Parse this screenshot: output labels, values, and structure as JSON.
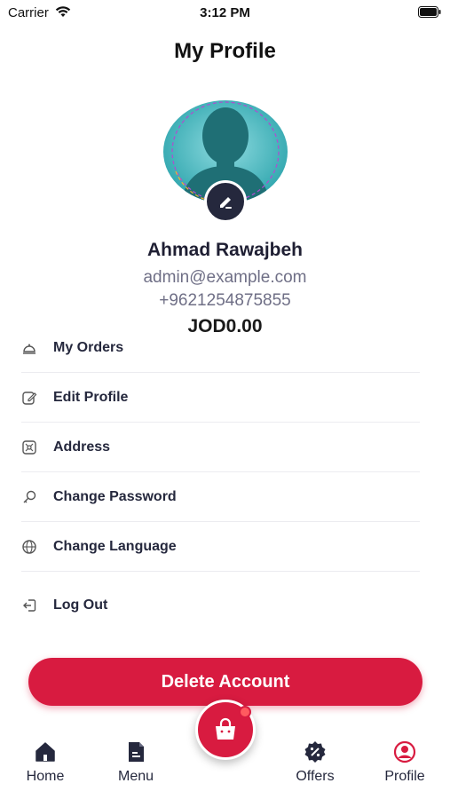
{
  "status_bar": {
    "carrier": "Carrier",
    "time": "3:12 PM"
  },
  "header": {
    "title": "My Profile"
  },
  "profile": {
    "name": "Ahmad Rawajbeh",
    "email": "admin@example.com",
    "phone": "+9621254875855",
    "balance": "JOD0.00"
  },
  "menu": {
    "items": [
      {
        "label": "My Orders",
        "icon": "orders-icon"
      },
      {
        "label": "Edit Profile",
        "icon": "edit-icon"
      },
      {
        "label": "Address",
        "icon": "map-icon"
      },
      {
        "label": "Change Password",
        "icon": "key-icon"
      },
      {
        "label": "Change Language",
        "icon": "globe-icon"
      }
    ],
    "logout_label": "Log Out"
  },
  "delete_account_label": "Delete Account",
  "bottom_nav": {
    "home": "Home",
    "menu": "Menu",
    "offers": "Offers",
    "profile": "Profile"
  },
  "colors": {
    "accent": "#d81b40",
    "dark": "#25283d",
    "avatar_bg": "#3fb3b8"
  }
}
